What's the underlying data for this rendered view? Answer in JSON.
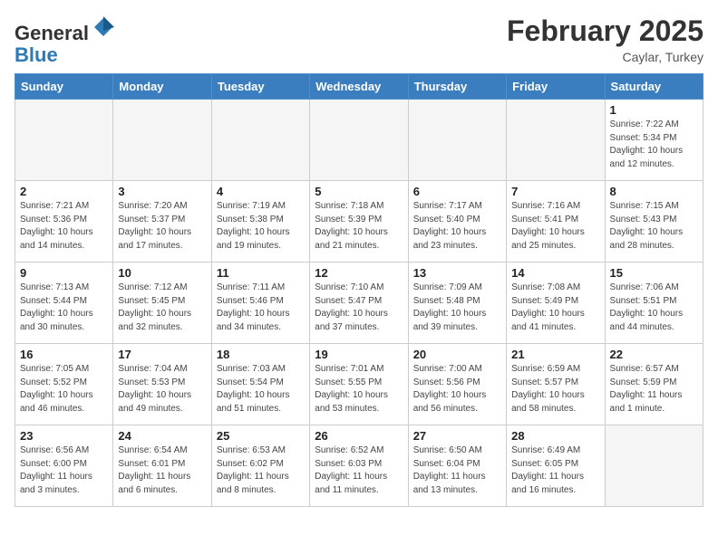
{
  "header": {
    "logo_line1": "General",
    "logo_line2": "Blue",
    "month": "February 2025",
    "location": "Caylar, Turkey"
  },
  "weekdays": [
    "Sunday",
    "Monday",
    "Tuesday",
    "Wednesday",
    "Thursday",
    "Friday",
    "Saturday"
  ],
  "weeks": [
    [
      {
        "day": "",
        "info": ""
      },
      {
        "day": "",
        "info": ""
      },
      {
        "day": "",
        "info": ""
      },
      {
        "day": "",
        "info": ""
      },
      {
        "day": "",
        "info": ""
      },
      {
        "day": "",
        "info": ""
      },
      {
        "day": "1",
        "info": "Sunrise: 7:22 AM\nSunset: 5:34 PM\nDaylight: 10 hours\nand 12 minutes."
      }
    ],
    [
      {
        "day": "2",
        "info": "Sunrise: 7:21 AM\nSunset: 5:36 PM\nDaylight: 10 hours\nand 14 minutes."
      },
      {
        "day": "3",
        "info": "Sunrise: 7:20 AM\nSunset: 5:37 PM\nDaylight: 10 hours\nand 17 minutes."
      },
      {
        "day": "4",
        "info": "Sunrise: 7:19 AM\nSunset: 5:38 PM\nDaylight: 10 hours\nand 19 minutes."
      },
      {
        "day": "5",
        "info": "Sunrise: 7:18 AM\nSunset: 5:39 PM\nDaylight: 10 hours\nand 21 minutes."
      },
      {
        "day": "6",
        "info": "Sunrise: 7:17 AM\nSunset: 5:40 PM\nDaylight: 10 hours\nand 23 minutes."
      },
      {
        "day": "7",
        "info": "Sunrise: 7:16 AM\nSunset: 5:41 PM\nDaylight: 10 hours\nand 25 minutes."
      },
      {
        "day": "8",
        "info": "Sunrise: 7:15 AM\nSunset: 5:43 PM\nDaylight: 10 hours\nand 28 minutes."
      }
    ],
    [
      {
        "day": "9",
        "info": "Sunrise: 7:13 AM\nSunset: 5:44 PM\nDaylight: 10 hours\nand 30 minutes."
      },
      {
        "day": "10",
        "info": "Sunrise: 7:12 AM\nSunset: 5:45 PM\nDaylight: 10 hours\nand 32 minutes."
      },
      {
        "day": "11",
        "info": "Sunrise: 7:11 AM\nSunset: 5:46 PM\nDaylight: 10 hours\nand 34 minutes."
      },
      {
        "day": "12",
        "info": "Sunrise: 7:10 AM\nSunset: 5:47 PM\nDaylight: 10 hours\nand 37 minutes."
      },
      {
        "day": "13",
        "info": "Sunrise: 7:09 AM\nSunset: 5:48 PM\nDaylight: 10 hours\nand 39 minutes."
      },
      {
        "day": "14",
        "info": "Sunrise: 7:08 AM\nSunset: 5:49 PM\nDaylight: 10 hours\nand 41 minutes."
      },
      {
        "day": "15",
        "info": "Sunrise: 7:06 AM\nSunset: 5:51 PM\nDaylight: 10 hours\nand 44 minutes."
      }
    ],
    [
      {
        "day": "16",
        "info": "Sunrise: 7:05 AM\nSunset: 5:52 PM\nDaylight: 10 hours\nand 46 minutes."
      },
      {
        "day": "17",
        "info": "Sunrise: 7:04 AM\nSunset: 5:53 PM\nDaylight: 10 hours\nand 49 minutes."
      },
      {
        "day": "18",
        "info": "Sunrise: 7:03 AM\nSunset: 5:54 PM\nDaylight: 10 hours\nand 51 minutes."
      },
      {
        "day": "19",
        "info": "Sunrise: 7:01 AM\nSunset: 5:55 PM\nDaylight: 10 hours\nand 53 minutes."
      },
      {
        "day": "20",
        "info": "Sunrise: 7:00 AM\nSunset: 5:56 PM\nDaylight: 10 hours\nand 56 minutes."
      },
      {
        "day": "21",
        "info": "Sunrise: 6:59 AM\nSunset: 5:57 PM\nDaylight: 10 hours\nand 58 minutes."
      },
      {
        "day": "22",
        "info": "Sunrise: 6:57 AM\nSunset: 5:59 PM\nDaylight: 11 hours\nand 1 minute."
      }
    ],
    [
      {
        "day": "23",
        "info": "Sunrise: 6:56 AM\nSunset: 6:00 PM\nDaylight: 11 hours\nand 3 minutes."
      },
      {
        "day": "24",
        "info": "Sunrise: 6:54 AM\nSunset: 6:01 PM\nDaylight: 11 hours\nand 6 minutes."
      },
      {
        "day": "25",
        "info": "Sunrise: 6:53 AM\nSunset: 6:02 PM\nDaylight: 11 hours\nand 8 minutes."
      },
      {
        "day": "26",
        "info": "Sunrise: 6:52 AM\nSunset: 6:03 PM\nDaylight: 11 hours\nand 11 minutes."
      },
      {
        "day": "27",
        "info": "Sunrise: 6:50 AM\nSunset: 6:04 PM\nDaylight: 11 hours\nand 13 minutes."
      },
      {
        "day": "28",
        "info": "Sunrise: 6:49 AM\nSunset: 6:05 PM\nDaylight: 11 hours\nand 16 minutes."
      },
      {
        "day": "",
        "info": ""
      }
    ]
  ]
}
